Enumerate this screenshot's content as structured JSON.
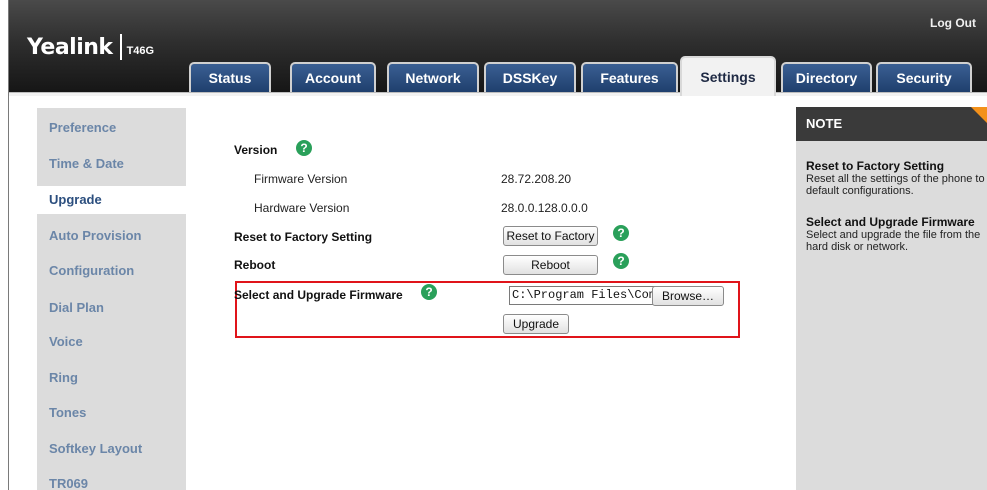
{
  "header": {
    "brand": "Yealink",
    "model": "T46G",
    "logout_label": "Log Out"
  },
  "tabs": [
    {
      "label": "Status",
      "active": false
    },
    {
      "label": "Account",
      "active": false
    },
    {
      "label": "Network",
      "active": false
    },
    {
      "label": "DSSKey",
      "active": false
    },
    {
      "label": "Features",
      "active": false
    },
    {
      "label": "Settings",
      "active": true
    },
    {
      "label": "Directory",
      "active": false
    },
    {
      "label": "Security",
      "active": false
    }
  ],
  "sidebar": {
    "items": [
      {
        "label": "Preference"
      },
      {
        "label": "Time & Date"
      },
      {
        "label": "Upgrade",
        "active": true
      },
      {
        "label": "Auto Provision"
      },
      {
        "label": "Configuration"
      },
      {
        "label": "Dial Plan"
      },
      {
        "label": "Voice"
      },
      {
        "label": "Ring"
      },
      {
        "label": "Tones"
      },
      {
        "label": "Softkey Layout"
      },
      {
        "label": "TR069"
      }
    ]
  },
  "main": {
    "version_label": "Version",
    "firmware_version_label": "Firmware Version",
    "firmware_version_value": "28.72.208.20",
    "hardware_version_label": "Hardware Version",
    "hardware_version_value": "28.0.0.128.0.0.0",
    "reset_label": "Reset to Factory Setting",
    "reset_button": "Reset to Factory",
    "reboot_label": "Reboot",
    "reboot_button": "Reboot",
    "upgrade_label": "Select and Upgrade Firmware",
    "file_value": "C:\\Program Files\\Comm",
    "browse_button": "Browse…",
    "upgrade_button": "Upgrade",
    "help_glyph": "?"
  },
  "note": {
    "heading": "NOTE",
    "sections": [
      {
        "title": "Reset to Factory Setting",
        "text": "Reset all the settings of the phone to default configurations."
      },
      {
        "title": "Select and Upgrade Firmware",
        "text": "Select and upgrade the file from the hard disk or network."
      }
    ]
  },
  "colors": {
    "tab_blue": "#2b4e7e",
    "sidebar_link": "#6b86a8",
    "help_green": "#2aa05a",
    "highlight_red": "#e0141a",
    "note_corner": "#f3911b"
  }
}
